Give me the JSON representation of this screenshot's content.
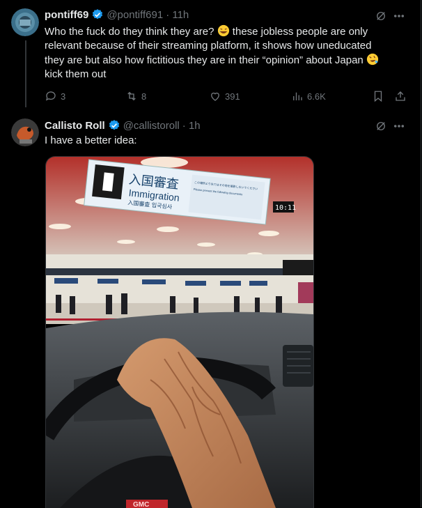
{
  "tweet1": {
    "name": "pontiff69",
    "handle": "@pontiff691",
    "time": "· 11h",
    "text_a": "Who the fuck do they think they are? ",
    "text_b": " these jobless people are only relevant because of their streaming platform, it shows how uneducated they are but also how fictitious they are in their “opinion” about Japan ",
    "text_c": " kick them out",
    "replies": "3",
    "reposts": "8",
    "likes": "391",
    "views": "6.6K"
  },
  "tweet2": {
    "name": "Callisto Roll",
    "handle": "@callistoroll",
    "time": "· 1h",
    "text": "I have a better idea:"
  },
  "media": {
    "sign_kanji": "入国審査",
    "sign_en": "Immigration",
    "sign_sub": "入国審査  입국심사",
    "sign_right": "この場所より先ではその他を撮影しないでください",
    "sign_right2": "Please prevent the following documents",
    "clock": "10:11",
    "car_badge": "GMC"
  },
  "colors": {
    "accent": "#1d9bf0",
    "muted": "#71767b",
    "bg": "#000000"
  },
  "icons": [
    "verified-icon",
    "grok-icon",
    "more-icon",
    "reply-icon",
    "repost-icon",
    "like-icon",
    "views-icon",
    "bookmark-icon",
    "share-icon",
    "laughing-emoji",
    "rofl-emoji"
  ]
}
